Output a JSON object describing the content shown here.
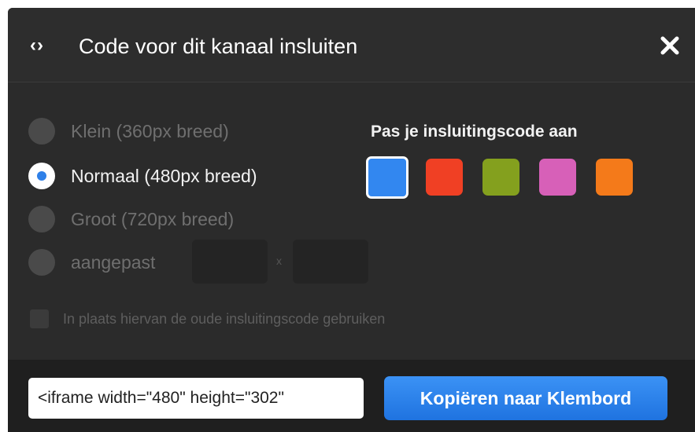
{
  "dialog": {
    "icon": "code-icon",
    "title": "Code voor dit kanaal insluiten",
    "close_icon": "close-icon"
  },
  "size_options": [
    {
      "label": "Klein (360px breed)",
      "checked": false
    },
    {
      "label": "Normaal (480px breed)",
      "checked": true
    },
    {
      "label": "Groot (720px breed)",
      "checked": false
    },
    {
      "label": "aangepast",
      "checked": false
    }
  ],
  "custom_size": {
    "width_value": "",
    "height_value": "",
    "separator": "x"
  },
  "customize": {
    "heading": "Pas je insluitingscode aan",
    "colors": [
      {
        "hex": "#3287f0",
        "selected": true
      },
      {
        "hex": "#f04024",
        "selected": false
      },
      {
        "hex": "#84a01e",
        "selected": false
      },
      {
        "hex": "#d760b8",
        "selected": false
      },
      {
        "hex": "#f47a1a",
        "selected": false
      }
    ]
  },
  "legacy": {
    "label": "In plaats hiervan de oude insluitingscode gebruiken",
    "checked": false
  },
  "footer": {
    "embed_code": "<iframe width=\"480\" height=\"302\"",
    "copy_button": "Kopiëren naar Klembord"
  }
}
